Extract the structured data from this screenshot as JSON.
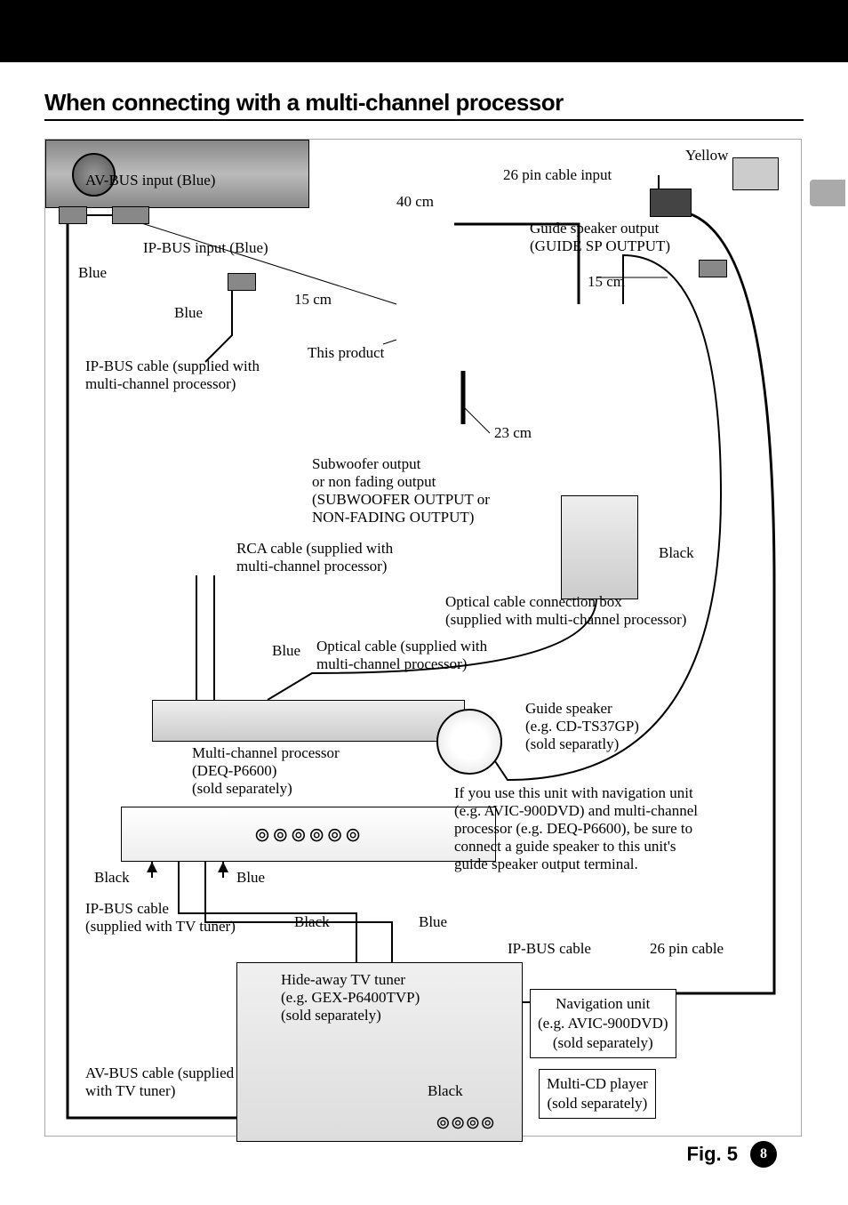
{
  "title": "When connecting with a multi-channel processor",
  "figure_label": "Fig. 5",
  "page_number": "8",
  "labels": {
    "yellow": "Yellow",
    "pin26_input": "26 pin cable input",
    "len40": "40 cm",
    "avbus_input": "AV-BUS input (Blue)",
    "ipbus_input": "IP-BUS input (Blue)",
    "blue1": "Blue",
    "blue2": "Blue",
    "len15a": "15 cm",
    "len15b": "15 cm",
    "guide_out_1": "Guide speaker output",
    "guide_out_2": "(GUIDE SP OUTPUT)",
    "this_product": "This product",
    "ipbus_cable_mcp_1": "IP-BUS cable (supplied with",
    "ipbus_cable_mcp_2": "multi-channel processor)",
    "len23": "23 cm",
    "sub_out_1": "Subwoofer output",
    "sub_out_2": "or non fading output",
    "sub_out_3": "(SUBWOOFER OUTPUT or",
    "sub_out_4": "NON-FADING OUTPUT)",
    "rca_1": "RCA cable (supplied with",
    "rca_2": "multi-channel processor)",
    "black1": "Black",
    "optical_box_1": "Optical cable connection box",
    "optical_box_2": "(supplied with multi-channel processor)",
    "blue3": "Blue",
    "optical_cable_1": "Optical cable (supplied with",
    "optical_cable_2": "multi-channel processor)",
    "mcp_1": "Multi-channel processor",
    "mcp_2": "(DEQ-P6600)",
    "mcp_3": "(sold separately)",
    "guide_spk_1": "Guide speaker",
    "guide_spk_2": "(e.g. CD-TS37GP)",
    "guide_spk_3": "(sold separatly)",
    "note_1": "If you use this unit with navigation unit",
    "note_2": "(e.g. AVIC-900DVD) and multi-channel",
    "note_3": "processor (e.g. DEQ-P6600), be sure to",
    "note_4": "connect a guide speaker to this unit's",
    "note_5": "guide speaker output terminal.",
    "black2": "Black",
    "blue4": "Blue",
    "ipbus_tv_1": "IP-BUS cable",
    "ipbus_tv_2": "(supplied with TV tuner)",
    "black3": "Black",
    "blue5": "Blue",
    "ipbus_cable_short": "IP-BUS cable",
    "pin26_cable": "26 pin cable",
    "tv_1": "Hide-away TV tuner",
    "tv_2": "(e.g. GEX-P6400TVP)",
    "tv_3": "(sold separately)",
    "avbus_tv_1": "AV-BUS cable (supplied",
    "avbus_tv_2": "with TV tuner)",
    "black4": "Black",
    "nav_1": "Navigation unit",
    "nav_2": "(e.g. AVIC-900DVD)",
    "nav_3": "(sold separately)",
    "cd_1": "Multi-CD player",
    "cd_2": "(sold separately)"
  }
}
